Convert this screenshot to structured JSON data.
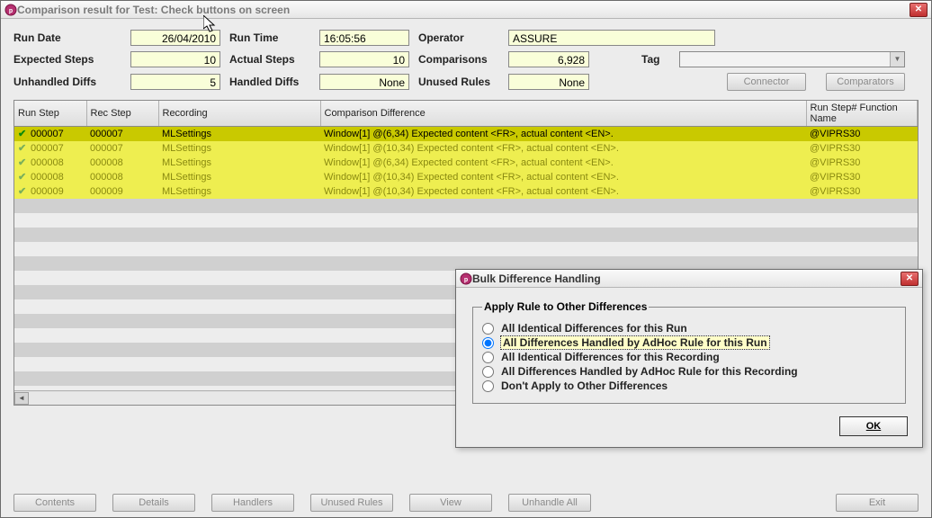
{
  "window": {
    "title": "Comparison result for Test: Check buttons on screen"
  },
  "fields": {
    "run_date": {
      "label": "Run Date",
      "value": "26/04/2010"
    },
    "run_time": {
      "label": "Run Time",
      "value": "16:05:56"
    },
    "operator": {
      "label": "Operator",
      "value": "ASSURE"
    },
    "expected_steps": {
      "label": "Expected Steps",
      "value": "10"
    },
    "actual_steps": {
      "label": "Actual Steps",
      "value": "10"
    },
    "comparisons": {
      "label": "Comparisons",
      "value": "6,928"
    },
    "tag": {
      "label": "Tag",
      "value": ""
    },
    "unhandled_diffs": {
      "label": "Unhandled Diffs",
      "value": "5"
    },
    "handled_diffs": {
      "label": "Handled Diffs",
      "value": "None"
    },
    "unused_rules": {
      "label": "Unused Rules",
      "value": "None"
    }
  },
  "buttons": {
    "connector": "Connector",
    "comparators": "Comparators",
    "contents": "Contents",
    "details": "Details",
    "handlers": "Handlers",
    "unused_rules": "Unused Rules",
    "view": "View",
    "unhandle_all": "Unhandle All",
    "exit": "Exit"
  },
  "table": {
    "headers": {
      "run_step": "Run Step",
      "rec_step": "Rec Step",
      "recording": "Recording",
      "diff": "Comparison Difference",
      "func": "Run Step# Function Name"
    },
    "rows": [
      {
        "sel": true,
        "run_step": "000007",
        "rec_step": "000007",
        "recording": "MLSettings",
        "diff": "Window[1] @(6,34) Expected content <FR>, actual content <EN>.",
        "func": "@VIPRS30"
      },
      {
        "sel": false,
        "run_step": "000007",
        "rec_step": "000007",
        "recording": "MLSettings",
        "diff": "Window[1] @(10,34) Expected content <FR>, actual content <EN>.",
        "func": "@VIPRS30"
      },
      {
        "sel": false,
        "run_step": "000008",
        "rec_step": "000008",
        "recording": "MLSettings",
        "diff": "Window[1] @(6,34) Expected content <FR>, actual content <EN>.",
        "func": "@VIPRS30"
      },
      {
        "sel": false,
        "run_step": "000008",
        "rec_step": "000008",
        "recording": "MLSettings",
        "diff": "Window[1] @(10,34) Expected content <FR>, actual content <EN>.",
        "func": "@VIPRS30"
      },
      {
        "sel": false,
        "run_step": "000009",
        "rec_step": "000009",
        "recording": "MLSettings",
        "diff": "Window[1] @(10,34) Expected content <FR>, actual content <EN>.",
        "func": "@VIPRS30"
      }
    ]
  },
  "dialog": {
    "title": "Bulk Difference Handling",
    "legend": "Apply Rule to Other Differences",
    "options": {
      "o1": "All Identical Differences for this Run",
      "o2": "All Differences Handled by AdHoc Rule for this Run",
      "o3": "All Identical Differences for this Recording",
      "o4": "All Differences Handled by AdHoc Rule for this Recording",
      "o5": "Don't Apply to Other Differences"
    },
    "ok": "OK"
  }
}
